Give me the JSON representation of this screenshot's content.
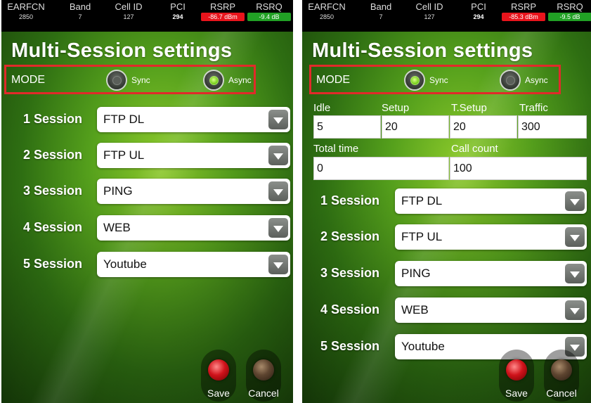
{
  "status_bar": {
    "columns": [
      {
        "header": "EARFCN",
        "value": "2850"
      },
      {
        "header": "Band",
        "value": "7"
      },
      {
        "header": "Cell ID",
        "value": "127"
      },
      {
        "header": "PCI",
        "value": "294"
      },
      {
        "header": "RSRP",
        "value": "-86.7 dBm"
      },
      {
        "header": "RSRQ",
        "value": "-9.4 dB"
      }
    ],
    "right_values": {
      "rsrp": "-85.3 dBm",
      "rsrq": "-9.5 dB"
    },
    "colors": {
      "rsrp_bg": "#e8141c",
      "rsrq_bg": "#21a025"
    }
  },
  "page_title": "Multi-Session settings",
  "mode": {
    "label": "MODE",
    "options": [
      "Sync",
      "Async"
    ],
    "left_selected": "Async",
    "right_selected": "Sync"
  },
  "timing": {
    "labels": {
      "idle": "Idle",
      "setup": "Setup",
      "t_setup": "T.Setup",
      "traffic": "Traffic",
      "total_time": "Total time",
      "call_count": "Call count"
    },
    "values": {
      "idle": "5",
      "setup": "20",
      "t_setup": "20",
      "traffic": "300",
      "total_time": "0",
      "call_count": "100"
    }
  },
  "sessions": [
    {
      "label": "1 Session",
      "value": "FTP DL"
    },
    {
      "label": "2 Session",
      "value": "FTP UL"
    },
    {
      "label": "3 Session",
      "value": "PING"
    },
    {
      "label": "4 Session",
      "value": "WEB"
    },
    {
      "label": "5 Session",
      "value": "Youtube"
    }
  ],
  "buttons": {
    "save": "Save",
    "cancel": "Cancel"
  },
  "icons": {
    "dropdown": "chevron-down-icon",
    "save": "red-led-icon",
    "cancel": "brown-led-icon"
  },
  "colors": {
    "highlight_border": "#e12a2a",
    "accent_green": "#7ed321"
  }
}
